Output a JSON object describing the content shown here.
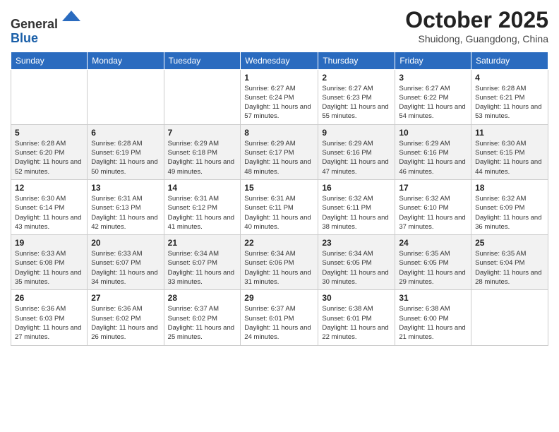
{
  "header": {
    "logo_line1": "General",
    "logo_line2": "Blue",
    "month": "October 2025",
    "location": "Shuidong, Guangdong, China"
  },
  "days_of_week": [
    "Sunday",
    "Monday",
    "Tuesday",
    "Wednesday",
    "Thursday",
    "Friday",
    "Saturday"
  ],
  "weeks": [
    [
      {
        "day": "",
        "info": ""
      },
      {
        "day": "",
        "info": ""
      },
      {
        "day": "",
        "info": ""
      },
      {
        "day": "1",
        "info": "Sunrise: 6:27 AM\nSunset: 6:24 PM\nDaylight: 11 hours and 57 minutes."
      },
      {
        "day": "2",
        "info": "Sunrise: 6:27 AM\nSunset: 6:23 PM\nDaylight: 11 hours and 55 minutes."
      },
      {
        "day": "3",
        "info": "Sunrise: 6:27 AM\nSunset: 6:22 PM\nDaylight: 11 hours and 54 minutes."
      },
      {
        "day": "4",
        "info": "Sunrise: 6:28 AM\nSunset: 6:21 PM\nDaylight: 11 hours and 53 minutes."
      }
    ],
    [
      {
        "day": "5",
        "info": "Sunrise: 6:28 AM\nSunset: 6:20 PM\nDaylight: 11 hours and 52 minutes."
      },
      {
        "day": "6",
        "info": "Sunrise: 6:28 AM\nSunset: 6:19 PM\nDaylight: 11 hours and 50 minutes."
      },
      {
        "day": "7",
        "info": "Sunrise: 6:29 AM\nSunset: 6:18 PM\nDaylight: 11 hours and 49 minutes."
      },
      {
        "day": "8",
        "info": "Sunrise: 6:29 AM\nSunset: 6:17 PM\nDaylight: 11 hours and 48 minutes."
      },
      {
        "day": "9",
        "info": "Sunrise: 6:29 AM\nSunset: 6:16 PM\nDaylight: 11 hours and 47 minutes."
      },
      {
        "day": "10",
        "info": "Sunrise: 6:29 AM\nSunset: 6:16 PM\nDaylight: 11 hours and 46 minutes."
      },
      {
        "day": "11",
        "info": "Sunrise: 6:30 AM\nSunset: 6:15 PM\nDaylight: 11 hours and 44 minutes."
      }
    ],
    [
      {
        "day": "12",
        "info": "Sunrise: 6:30 AM\nSunset: 6:14 PM\nDaylight: 11 hours and 43 minutes."
      },
      {
        "day": "13",
        "info": "Sunrise: 6:31 AM\nSunset: 6:13 PM\nDaylight: 11 hours and 42 minutes."
      },
      {
        "day": "14",
        "info": "Sunrise: 6:31 AM\nSunset: 6:12 PM\nDaylight: 11 hours and 41 minutes."
      },
      {
        "day": "15",
        "info": "Sunrise: 6:31 AM\nSunset: 6:11 PM\nDaylight: 11 hours and 40 minutes."
      },
      {
        "day": "16",
        "info": "Sunrise: 6:32 AM\nSunset: 6:11 PM\nDaylight: 11 hours and 38 minutes."
      },
      {
        "day": "17",
        "info": "Sunrise: 6:32 AM\nSunset: 6:10 PM\nDaylight: 11 hours and 37 minutes."
      },
      {
        "day": "18",
        "info": "Sunrise: 6:32 AM\nSunset: 6:09 PM\nDaylight: 11 hours and 36 minutes."
      }
    ],
    [
      {
        "day": "19",
        "info": "Sunrise: 6:33 AM\nSunset: 6:08 PM\nDaylight: 11 hours and 35 minutes."
      },
      {
        "day": "20",
        "info": "Sunrise: 6:33 AM\nSunset: 6:07 PM\nDaylight: 11 hours and 34 minutes."
      },
      {
        "day": "21",
        "info": "Sunrise: 6:34 AM\nSunset: 6:07 PM\nDaylight: 11 hours and 33 minutes."
      },
      {
        "day": "22",
        "info": "Sunrise: 6:34 AM\nSunset: 6:06 PM\nDaylight: 11 hours and 31 minutes."
      },
      {
        "day": "23",
        "info": "Sunrise: 6:34 AM\nSunset: 6:05 PM\nDaylight: 11 hours and 30 minutes."
      },
      {
        "day": "24",
        "info": "Sunrise: 6:35 AM\nSunset: 6:05 PM\nDaylight: 11 hours and 29 minutes."
      },
      {
        "day": "25",
        "info": "Sunrise: 6:35 AM\nSunset: 6:04 PM\nDaylight: 11 hours and 28 minutes."
      }
    ],
    [
      {
        "day": "26",
        "info": "Sunrise: 6:36 AM\nSunset: 6:03 PM\nDaylight: 11 hours and 27 minutes."
      },
      {
        "day": "27",
        "info": "Sunrise: 6:36 AM\nSunset: 6:02 PM\nDaylight: 11 hours and 26 minutes."
      },
      {
        "day": "28",
        "info": "Sunrise: 6:37 AM\nSunset: 6:02 PM\nDaylight: 11 hours and 25 minutes."
      },
      {
        "day": "29",
        "info": "Sunrise: 6:37 AM\nSunset: 6:01 PM\nDaylight: 11 hours and 24 minutes."
      },
      {
        "day": "30",
        "info": "Sunrise: 6:38 AM\nSunset: 6:01 PM\nDaylight: 11 hours and 22 minutes."
      },
      {
        "day": "31",
        "info": "Sunrise: 6:38 AM\nSunset: 6:00 PM\nDaylight: 11 hours and 21 minutes."
      },
      {
        "day": "",
        "info": ""
      }
    ]
  ]
}
